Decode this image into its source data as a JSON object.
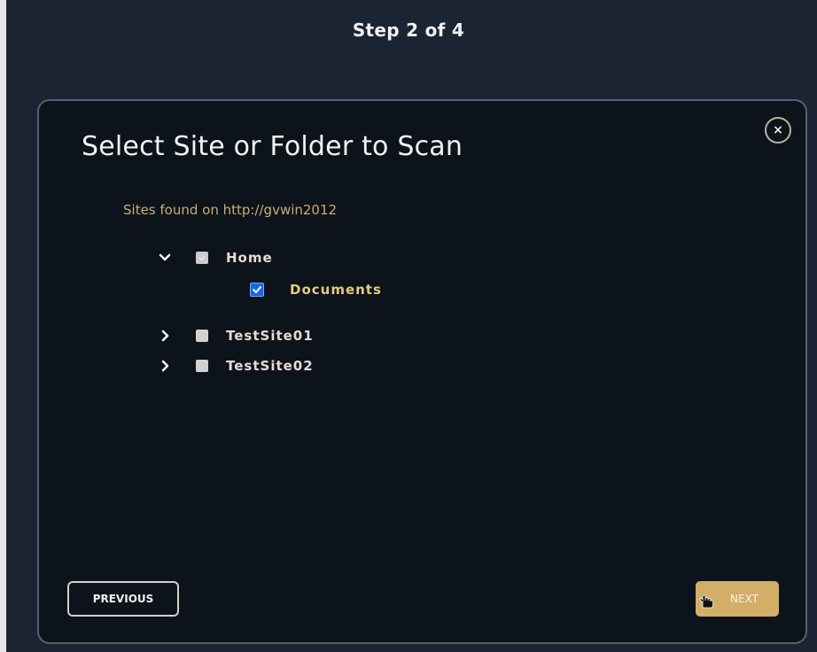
{
  "header": {
    "step_label": "Step 2 of  4"
  },
  "dialog": {
    "title": "Select Site or Folder to Scan",
    "close_label": "×",
    "sites_found_label": "Sites found on http://gvwin2012",
    "tree": {
      "home": {
        "label": "Home",
        "expanded": true,
        "check_state": "partial",
        "children": {
          "documents": {
            "label": "Documents",
            "check_state": "checked"
          }
        }
      },
      "testsite01": {
        "label": "TestSite01",
        "expanded": false,
        "check_state": "unchecked"
      },
      "testsite02": {
        "label": "TestSite02",
        "expanded": false,
        "check_state": "unchecked"
      }
    },
    "footer": {
      "previous_label": "PREVIOUS",
      "next_label": "NEXT"
    }
  },
  "icons": {
    "close": "close-icon",
    "expand": "chevron-down-icon",
    "collapse": "chevron-right-icon",
    "cursor": "hand-pointer-icon"
  },
  "colors": {
    "background": "#1b2433",
    "dialog_background": "#0d131a",
    "accent_gold": "#d2ae69",
    "label_gold": "#c8ad74",
    "checkbox_blue": "#1c66e0"
  }
}
